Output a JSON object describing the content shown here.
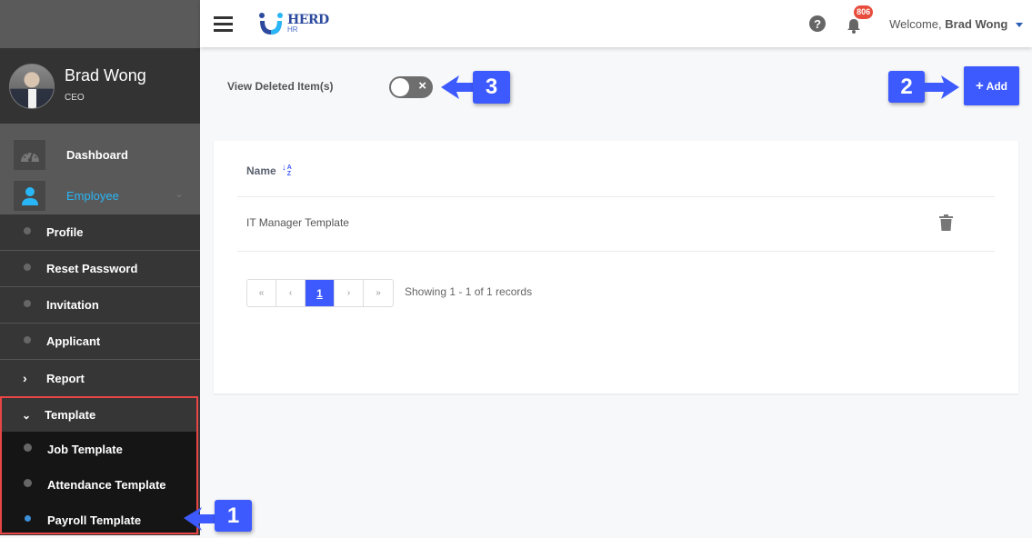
{
  "app": {
    "logo_main": "HERD",
    "logo_sub": "HR"
  },
  "topbar": {
    "notification_count": "806",
    "welcome_prefix": "Welcome,",
    "user_name": "Brad Wong"
  },
  "profile": {
    "name": "Brad Wong",
    "role": "CEO"
  },
  "sidebar": {
    "main_items": [
      {
        "label": "Dashboard",
        "icon": "dashboard-gauge-icon"
      },
      {
        "label": "Employee",
        "icon": "user-icon",
        "active": true
      }
    ],
    "sub_items": [
      {
        "label": "Profile",
        "type": "dot"
      },
      {
        "label": "Reset Password",
        "type": "dot"
      },
      {
        "label": "Invitation",
        "type": "dot"
      },
      {
        "label": "Applicant",
        "type": "dot"
      },
      {
        "label": "Report",
        "type": "collapsed"
      }
    ],
    "template_group": {
      "label": "Template",
      "items": [
        {
          "label": "Job Template"
        },
        {
          "label": "Attendance Template"
        },
        {
          "label": "Payroll Template",
          "active": true
        }
      ]
    }
  },
  "content": {
    "view_deleted_label": "View Deleted Item(s)",
    "view_deleted_on": false,
    "add_label": "Add",
    "table": {
      "columns": [
        "Name"
      ],
      "rows": [
        {
          "name": "IT Manager Template"
        }
      ]
    },
    "pagination": {
      "first": "«",
      "prev": "‹",
      "current": "1",
      "next": "›",
      "last": "»",
      "summary": "Showing 1 - 1 of 1 records"
    }
  },
  "annotations": {
    "one": "1",
    "two": "2",
    "three": "3"
  },
  "colors": {
    "accent": "#3d5afe",
    "sidebar_dark": "#363636",
    "highlight_border": "#e84545",
    "employee_active": "#29b6f6",
    "badge": "#e74c3c"
  }
}
